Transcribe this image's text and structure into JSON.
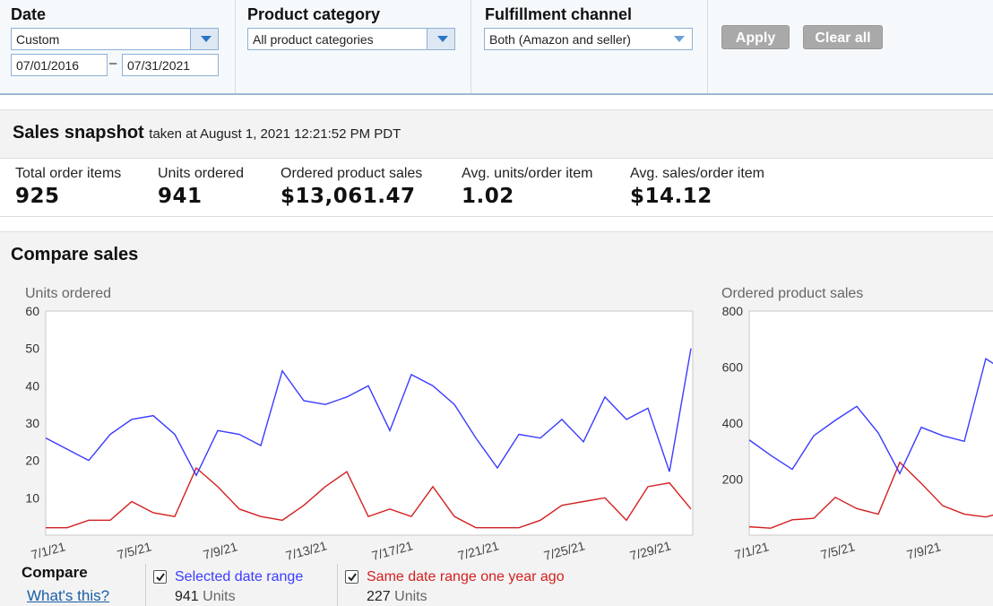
{
  "filters": {
    "date": {
      "label": "Date",
      "select_value": "Custom",
      "from": "07/01/2016",
      "dash": "–",
      "to": "07/31/2021"
    },
    "product_category": {
      "label": "Product category",
      "select_value": "All product categories"
    },
    "fulfillment_channel": {
      "label": "Fulfillment channel",
      "select_value": "Both (Amazon and seller)"
    },
    "apply_label": "Apply",
    "clear_label": "Clear all"
  },
  "snapshot": {
    "title": "Sales snapshot",
    "subtitle": "taken at August 1, 2021 12:21:52 PM PDT",
    "metrics": [
      {
        "label": "Total order items",
        "value": "925"
      },
      {
        "label": "Units ordered",
        "value": "941"
      },
      {
        "label": "Ordered product sales",
        "value": "$13,061.47"
      },
      {
        "label": "Avg. units/order item",
        "value": "1.02"
      },
      {
        "label": "Avg. sales/order item",
        "value": "$14.12"
      }
    ]
  },
  "compare": {
    "title": "Compare sales",
    "label": "Compare",
    "whats_this": "What's this?",
    "legend": [
      {
        "text": "Selected date range",
        "count": "941",
        "unit": "Units",
        "color": "#3b3bff",
        "checked": true
      },
      {
        "text": "Same date range one year ago",
        "count": "227",
        "unit": "Units",
        "color": "#d42020",
        "checked": true
      }
    ]
  },
  "chart_data": [
    {
      "type": "line",
      "title": "Units ordered",
      "ylim": [
        0,
        60
      ],
      "yticks": [
        "10",
        "20",
        "30",
        "40",
        "50",
        "60"
      ],
      "x": [
        "7/1/21",
        "7/2/21",
        "7/3/21",
        "7/4/21",
        "7/5/21",
        "7/6/21",
        "7/7/21",
        "7/8/21",
        "7/9/21",
        "7/10/21",
        "7/11/21",
        "7/12/21",
        "7/13/21",
        "7/14/21",
        "7/15/21",
        "7/16/21",
        "7/17/21",
        "7/18/21",
        "7/19/21",
        "7/20/21",
        "7/21/21",
        "7/22/21",
        "7/23/21",
        "7/24/21",
        "7/25/21",
        "7/26/21",
        "7/27/21",
        "7/28/21",
        "7/29/21",
        "7/30/21",
        "7/31/21"
      ],
      "xticklabels": [
        "7/1/21",
        "7/5/21",
        "7/9/21",
        "7/13/21",
        "7/17/21",
        "7/21/21",
        "7/25/21",
        "7/29/21"
      ],
      "series": [
        {
          "name": "Selected date range",
          "color": "#3b3bff",
          "values": [
            26,
            23,
            20,
            27,
            31,
            32,
            27,
            16,
            28,
            27,
            24,
            44,
            36,
            35,
            37,
            40,
            28,
            43,
            40,
            35,
            26,
            18,
            27,
            26,
            31,
            25,
            37,
            31,
            34,
            17,
            50
          ]
        },
        {
          "name": "Same date range one year ago",
          "color": "#d42020",
          "values": [
            2,
            2,
            4,
            4,
            9,
            6,
            5,
            18,
            13,
            7,
            5,
            4,
            8,
            13,
            17,
            5,
            7,
            5,
            13,
            5,
            2,
            2,
            2,
            4,
            8,
            9,
            10,
            4,
            13,
            14,
            7
          ]
        }
      ],
      "grid": false
    },
    {
      "type": "line",
      "title": "Ordered product sales",
      "ylim": [
        0,
        800
      ],
      "yticks": [
        "200",
        "400",
        "600",
        "800"
      ],
      "x": [
        "7/1/21",
        "7/2/21",
        "7/3/21",
        "7/4/21",
        "7/5/21",
        "7/6/21",
        "7/7/21",
        "7/8/21",
        "7/9/21",
        "7/10/21",
        "7/11/21",
        "7/12/21",
        "7/13/21"
      ],
      "xticklabels": [
        "7/1/21",
        "7/5/21",
        "7/9/21"
      ],
      "series": [
        {
          "name": "Selected date range",
          "color": "#3b3bff",
          "values": [
            340,
            285,
            235,
            355,
            410,
            460,
            365,
            220,
            385,
            355,
            335,
            630,
            580
          ]
        },
        {
          "name": "Same date range one year ago",
          "color": "#d42020",
          "values": [
            30,
            25,
            55,
            60,
            135,
            95,
            75,
            260,
            185,
            105,
            75,
            65,
            85
          ]
        }
      ],
      "grid": false
    }
  ]
}
